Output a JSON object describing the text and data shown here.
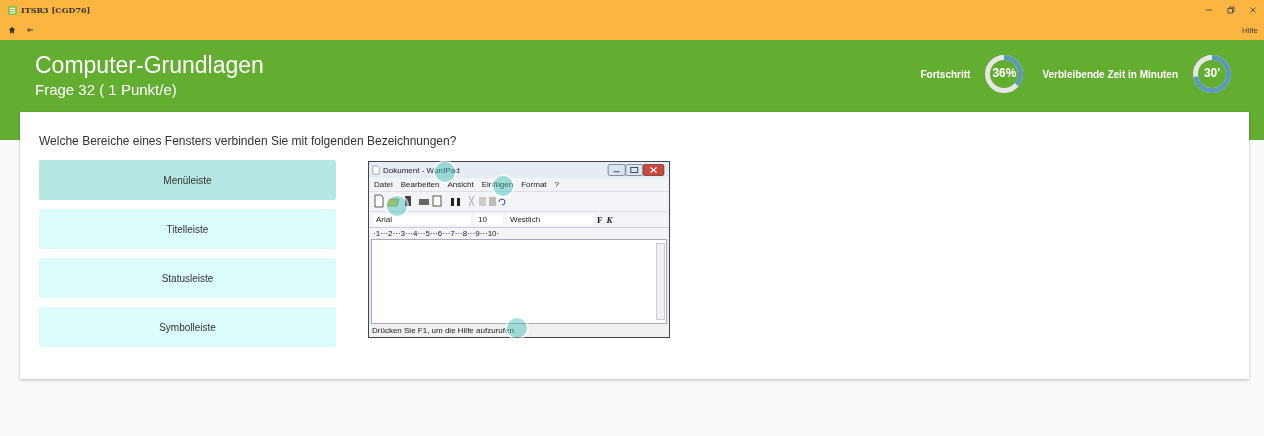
{
  "window": {
    "title": "ITSR3 [CGD76]",
    "help": "Hilfe"
  },
  "header": {
    "title": "Computer-Grundlagen",
    "subtitle": "Frage 32 ( 1 Punkt/e)",
    "meters": [
      {
        "label": "Fortschritt",
        "value": "36%",
        "level": 0.36
      },
      {
        "label": "Verbleibende Zeit in Minuten",
        "value": "30'",
        "level": 0.72
      }
    ]
  },
  "question": "Welche Bereiche eines Fensters verbinden Sie mit folgenden Bezeichnungen?",
  "options": [
    {
      "label": "Menüleiste",
      "selected": true
    },
    {
      "label": "Titelleiste",
      "selected": false
    },
    {
      "label": "Statusleiste",
      "selected": false
    },
    {
      "label": "Symbolleiste",
      "selected": false
    }
  ],
  "wordpad": {
    "title": "Dokument - WordPad",
    "menu": [
      "Datei",
      "Bearbeiten",
      "Ansicht",
      "Einfügen",
      "Format",
      "?"
    ],
    "font": "Arial",
    "size": "10",
    "script": "Westlich",
    "bold": "F",
    "italic": "K",
    "ruler": "·1···2···3···4···5···6···7···8···9···10·",
    "status": "Drücken Sie F1, um die Hilfe aufzurufen."
  }
}
